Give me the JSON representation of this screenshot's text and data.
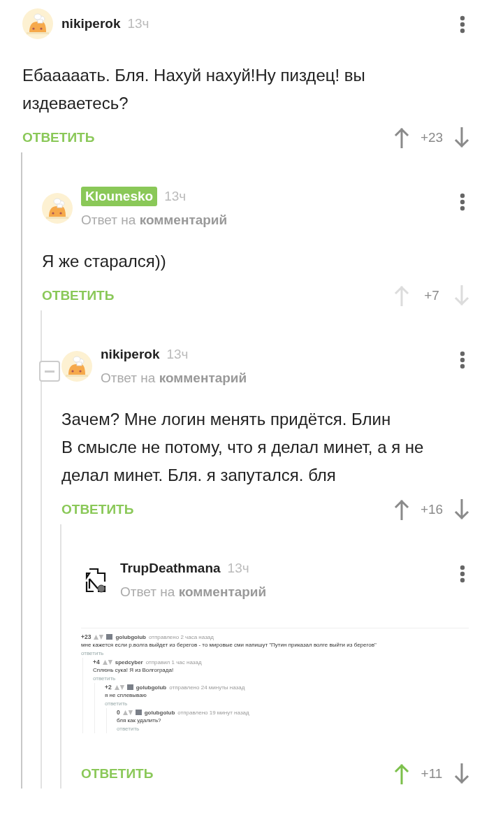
{
  "comments": [
    {
      "avatar": {
        "kind": "cook"
      },
      "author": "nikiperok",
      "author_highlighted": false,
      "time": "13ч",
      "text": "Ебааааать. Бля. Нахуй нахуй!Ну пиздец! вы издеваетесь?",
      "reply_label": "ОТВЕТИТЬ",
      "rating": "+23",
      "upvoted": false,
      "votes_disabled": false,
      "collapse_button": false,
      "children": [
        {
          "avatar": {
            "kind": "cook"
          },
          "author": "Klounesko",
          "author_highlighted": true,
          "time": "13ч",
          "reply_to": {
            "label": "Ответ на",
            "link": "комментарий"
          },
          "text": "Я же старался))",
          "reply_label": "ОТВЕТИТЬ",
          "rating": "+7",
          "upvoted": false,
          "votes_disabled": true,
          "collapse_button": false,
          "children": [
            {
              "avatar": {
                "kind": "cook"
              },
              "author": "nikiperok",
              "author_highlighted": false,
              "time": "13ч",
              "reply_to": {
                "label": "Ответ на",
                "link": "комментарий"
              },
              "text": "Зачем? Мне логин менять придётся. Блин\nВ смысле не потому, что я делал минет, а я не делал минет. Бля. я запутался. бля",
              "reply_label": "ОТВЕТИТЬ",
              "rating": "+16",
              "upvoted": false,
              "votes_disabled": false,
              "collapse_button": true,
              "children": [
                {
                  "avatar": {
                    "kind": "logo"
                  },
                  "author": "TrupDeathmana",
                  "author_highlighted": false,
                  "time": "13ч",
                  "reply_to": {
                    "label": "Ответ на",
                    "link": "комментарий"
                  },
                  "reply_label": "ОТВЕТИТЬ",
                  "rating": "+11",
                  "upvoted": true,
                  "votes_disabled": false,
                  "collapse_button": false,
                  "attachment": {
                    "kind": "screenshot",
                    "comments": [
                      {
                        "score": "+23",
                        "user": "golubgolub",
                        "has_avatar": true,
                        "meta": "отправлено 2 часа назад",
                        "text": "мне кажется если р.волга выйдет из берегов - то мировые сми напишут \"Путин приказал волге выйти из берегов\"",
                        "reply": "ответить",
                        "children": [
                          {
                            "score": "+4",
                            "user": "spedcyber",
                            "has_avatar": false,
                            "meta": "отправил 1 час назад",
                            "text": "Сплюнь сука! Я из Волгограда!",
                            "reply": "ответить",
                            "children": [
                              {
                                "score": "+2",
                                "user": "golubgolub",
                                "has_avatar": true,
                                "meta": "отправлено 24 минуты назад",
                                "text": "я не сплевываю",
                                "reply": "ответить",
                                "children": [
                                  {
                                    "score": "0",
                                    "user": "golubgolub",
                                    "has_avatar": true,
                                    "meta": "отправлено 19 минут назад",
                                    "text": "бля как удалить?",
                                    "reply": "ответить"
                                  }
                                ]
                              }
                            ]
                          }
                        ]
                      }
                    ]
                  }
                }
              ]
            }
          ]
        }
      ]
    }
  ]
}
